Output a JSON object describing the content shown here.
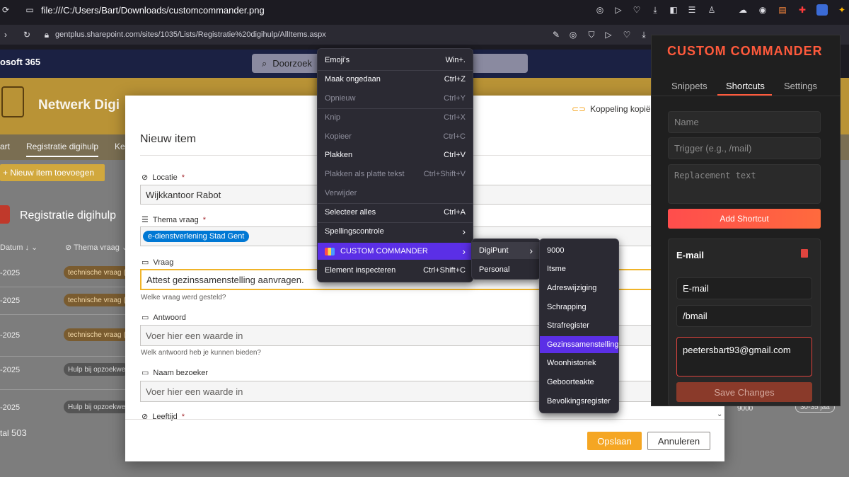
{
  "browser": {
    "top_url": "file:///C:/Users/Bart/Downloads/customcommander.png",
    "url": "gentplus.sharepoint.com/sites/1035/Lists/Registratie%20digihulp/AllItems.aspx"
  },
  "sharepoint": {
    "brand": "osoft 365",
    "search_placeholder": "Doorzoek",
    "site_title": "Netwerk Digi",
    "nav": [
      "art",
      "Registratie digihulp",
      "Ke"
    ],
    "new_item": "+ Nieuw item toevoegen",
    "list_title": "Registratie digihulp",
    "col_date": "Datum ↓ ⌄",
    "col_theme": "Thema vraag ⌄",
    "rows": [
      {
        "date": "-2025",
        "tag": "technische vraag (",
        "grey": false
      },
      {
        "date": "-2025",
        "tag": "technische vraag (",
        "grey": false
      },
      {
        "date": "-2025",
        "tag": "technische vraag (",
        "grey": false
      },
      {
        "date": "-2025",
        "tag": "Hulp bij opzoekwe",
        "grey": true
      },
      {
        "date": "-2025",
        "tag": "Hulp bij opzoekwe",
        "grey": true
      }
    ],
    "total_label": "tal",
    "total_value": "503",
    "right_value": "9000",
    "right_tag": "30-35 jaa"
  },
  "dialog": {
    "title": "Nieuw item",
    "copy_link": "Koppeling kopiëre",
    "fields": [
      {
        "label": "Locatie",
        "required": true,
        "value": "Wijkkantoor Rabot"
      },
      {
        "label": "Thema vraag",
        "required": true,
        "chip": "e-dienstverlening Stad Gent"
      },
      {
        "label": "Vraag",
        "required": false,
        "value": "Attest gezinssamenstelling aanvragen.",
        "help": "Welke vraag werd gesteld?"
      },
      {
        "label": "Antwoord",
        "required": false,
        "placeholder": "Voer hier een waarde in",
        "help": "Welk antwoord heb je kunnen bieden?"
      },
      {
        "label": "Naam bezoeker",
        "required": false,
        "placeholder": "Voer hier een waarde in"
      },
      {
        "label": "Leeftijd",
        "required": true
      }
    ],
    "save": "Opslaan",
    "cancel": "Annuleren"
  },
  "context_menu": {
    "items": [
      {
        "label": "Emoji's",
        "shortcut": "Win+.",
        "disabled": false
      },
      {
        "label": "Maak ongedaan",
        "shortcut": "Ctrl+Z",
        "disabled": false
      },
      {
        "label": "Opnieuw",
        "shortcut": "Ctrl+Y",
        "disabled": true
      },
      {
        "label": "Knip",
        "shortcut": "Ctrl+X",
        "disabled": true
      },
      {
        "label": "Kopieer",
        "shortcut": "Ctrl+C",
        "disabled": true
      },
      {
        "label": "Plakken",
        "shortcut": "Ctrl+V",
        "disabled": false
      },
      {
        "label": "Plakken als platte tekst",
        "shortcut": "Ctrl+Shift+V",
        "disabled": true
      },
      {
        "label": "Verwijder",
        "shortcut": "",
        "disabled": true
      },
      {
        "label": "Selecteer alles",
        "shortcut": "Ctrl+A",
        "disabled": false
      },
      {
        "label": "Spellingscontrole",
        "shortcut": "›",
        "disabled": false
      },
      {
        "label": "CUSTOM COMMANDER",
        "shortcut": "›",
        "disabled": false
      },
      {
        "label": "Element inspecteren",
        "shortcut": "Ctrl+Shift+C",
        "disabled": false
      }
    ],
    "sub1": [
      "DigiPunt",
      "Personal"
    ],
    "sub1_arrow": "›",
    "sub2": [
      "9000",
      "Itsme",
      "Adreswijziging",
      "Schrapping",
      "Strafregister",
      "Gezinssamenstelling",
      "Woonhistoriek",
      "Geboorteakte",
      "Bevolkingsregister"
    ]
  },
  "extension": {
    "title": "CUSTOM COMMANDER",
    "tabs": [
      "Snippets",
      "Shortcuts",
      "Settings"
    ],
    "name_placeholder": "Name",
    "trigger_placeholder": "Trigger (e.g., /mail)",
    "replacement_placeholder": "Replacement text",
    "add_button": "Add Shortcut",
    "card_title": "E-mail",
    "card_name": "E-mail",
    "card_trigger": "/bmail",
    "card_replacement": "peetersbart93@gmail.com",
    "save_button": "Save Changes"
  }
}
